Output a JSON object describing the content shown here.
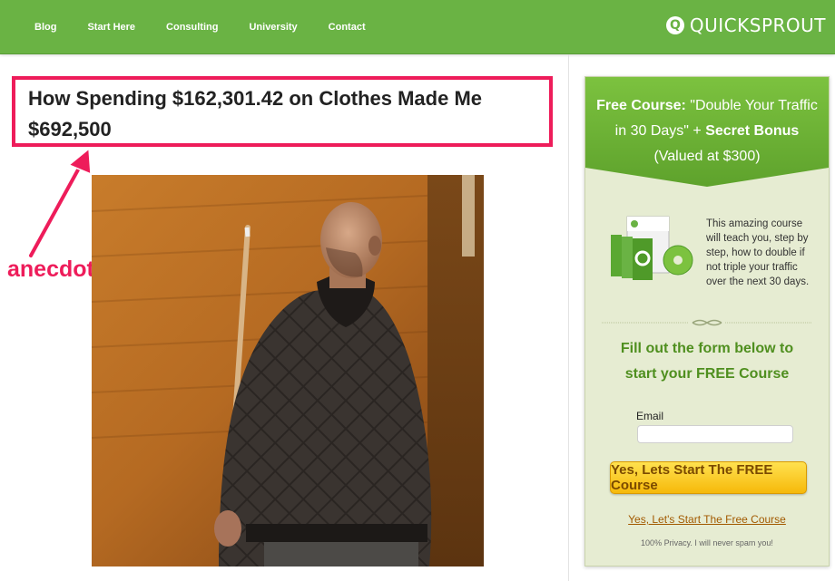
{
  "nav": {
    "items": [
      "Blog",
      "Start Here",
      "Consulting",
      "University",
      "Contact"
    ],
    "brand_icon_glyph": "Q",
    "brand_text": "QUICKSPROUT"
  },
  "post": {
    "title": "How Spending $162,301.42 on Clothes Made Me $692,500",
    "photo_icon": "man-in-quilted-jacket-photo"
  },
  "annotation": {
    "label": "anecdote",
    "color": "#ee1c5a"
  },
  "sidebar": {
    "offer_line1_bold": "Free Course:",
    "offer_line1_rest": " \"Double Your Traffic",
    "offer_line2_rest": "in 30 Days\" + ",
    "offer_line2_bold": "Secret Bonus",
    "offer_line3": "(Valued at $300)",
    "product_icon": "quicksprout-course-box-icon",
    "product_description": "This amazing course will teach you, step by step, how to double if not triple your traffic over the next 30 days.",
    "form_heading_line1": "Fill out the form below to",
    "form_heading_line2": "start your FREE Course",
    "email_label": "Email",
    "email_value": "",
    "email_placeholder": "",
    "cta_label": "Yes, Lets Start The FREE Course",
    "link_label": "Yes, Let's Start The Free Course",
    "privacy": "100% Privacy. I will never spam you!"
  },
  "colors": {
    "nav_green": "#6ab344",
    "sidebar_bg": "#e6ecd2",
    "heading_green": "#4f8f1f",
    "button_yellow": "#f6b90a"
  }
}
